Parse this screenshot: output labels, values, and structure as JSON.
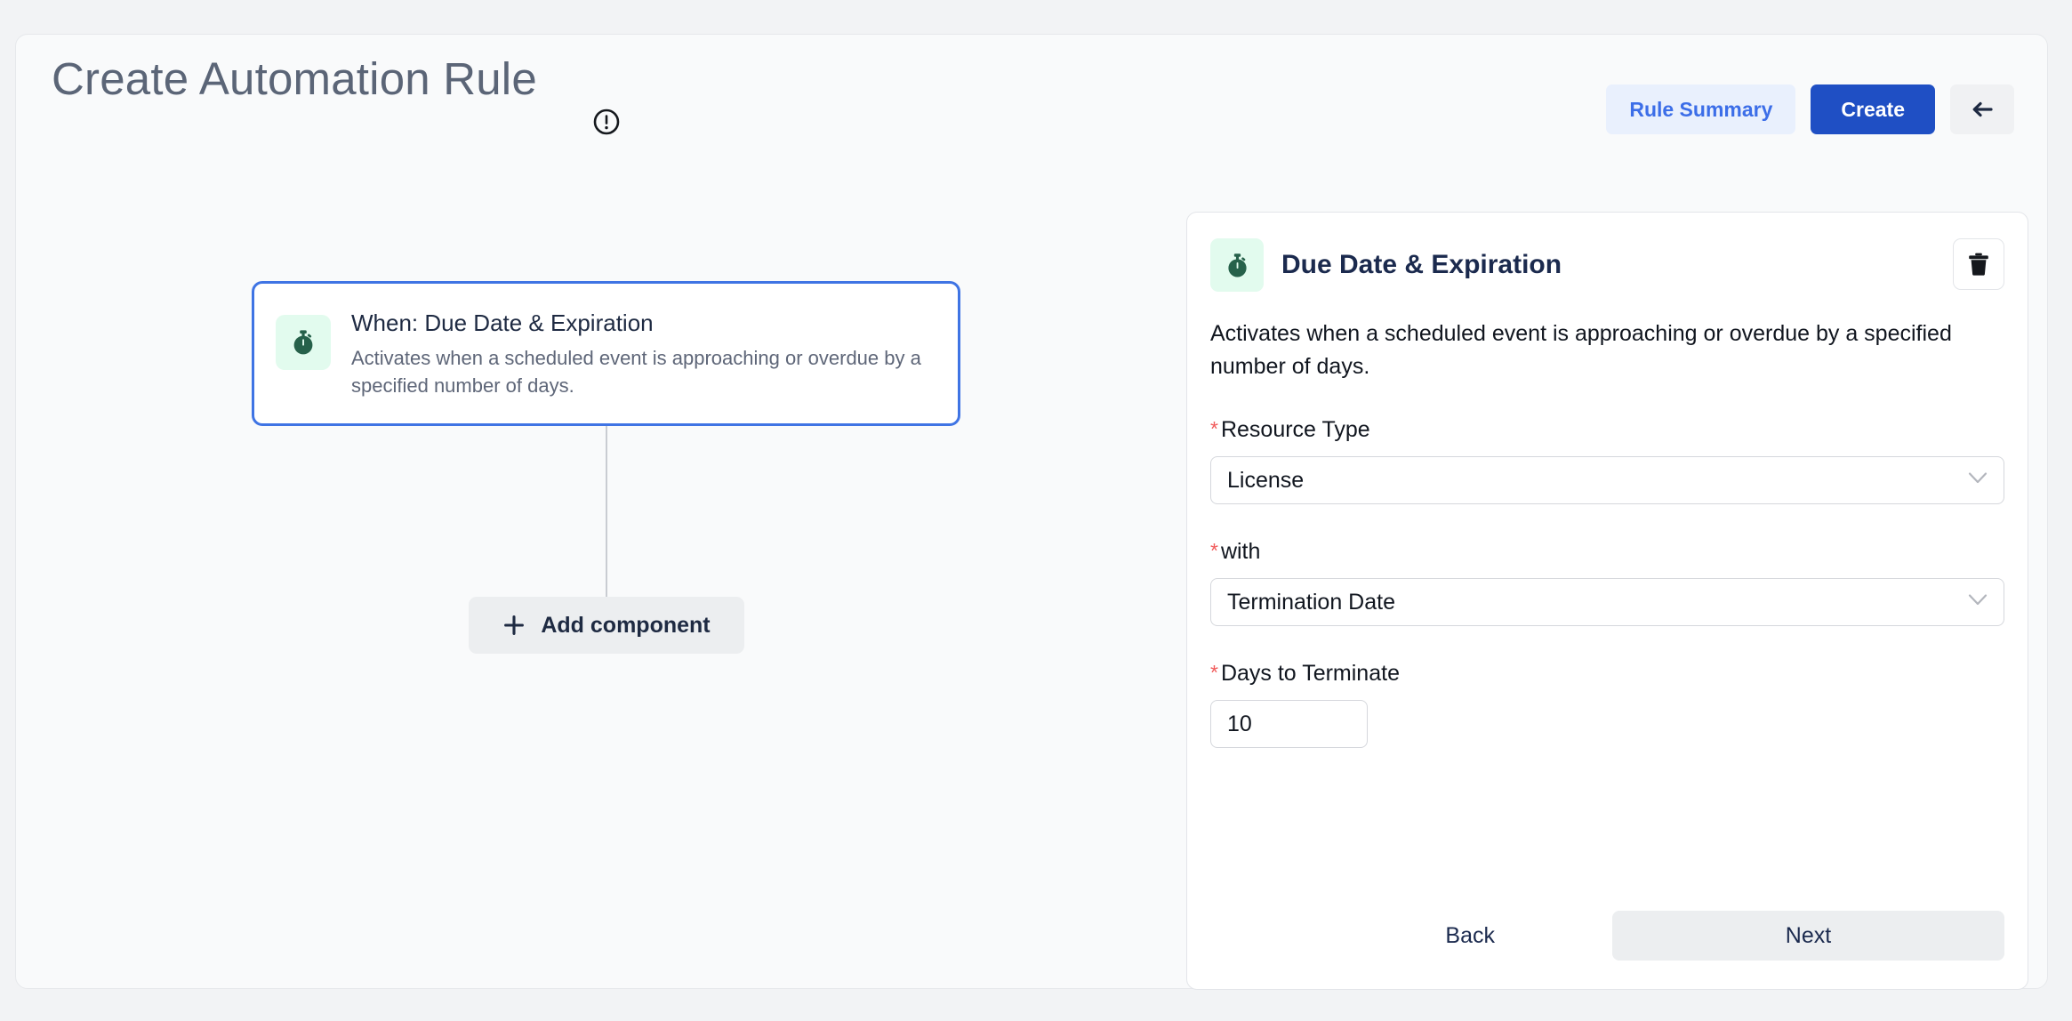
{
  "header": {
    "title": "Create Automation Rule",
    "info_icon": "exclamation-circle-icon",
    "rule_summary_label": "Rule Summary",
    "create_label": "Create",
    "back_arrow_icon": "arrow-left-icon"
  },
  "canvas": {
    "node": {
      "icon": "stopwatch-icon",
      "title": "When: Due Date & Expiration",
      "description": "Activates when a scheduled event is approaching or overdue by a specified number of days."
    },
    "add_component_label": "Add component",
    "add_component_icon": "plus-icon"
  },
  "panel": {
    "icon": "stopwatch-icon",
    "title": "Due Date & Expiration",
    "delete_icon": "trash-icon",
    "description": "Activates when a scheduled event is approaching or overdue by a specified number of days.",
    "fields": [
      {
        "required_marker": "*",
        "label": "Resource Type",
        "value": "License",
        "chevron_icon": "chevron-down-icon"
      },
      {
        "required_marker": "*",
        "label": "with",
        "value": "Termination Date",
        "chevron_icon": "chevron-down-icon"
      },
      {
        "required_marker": "*",
        "label": "Days to Terminate",
        "value": "10"
      }
    ],
    "back_label": "Back",
    "next_label": "Next"
  },
  "colors": {
    "accent_blue": "#1f4fc4",
    "node_border_blue": "#3f74e4",
    "rule_summary_bg": "#e9f0fd",
    "rule_summary_text": "#3c6ee8",
    "icon_tile_bg": "#e2fbee",
    "icon_green": "#26614a",
    "required_red": "#f15b5b",
    "panel_bg": "#ffffff",
    "page_bg": "#f9fafb"
  }
}
